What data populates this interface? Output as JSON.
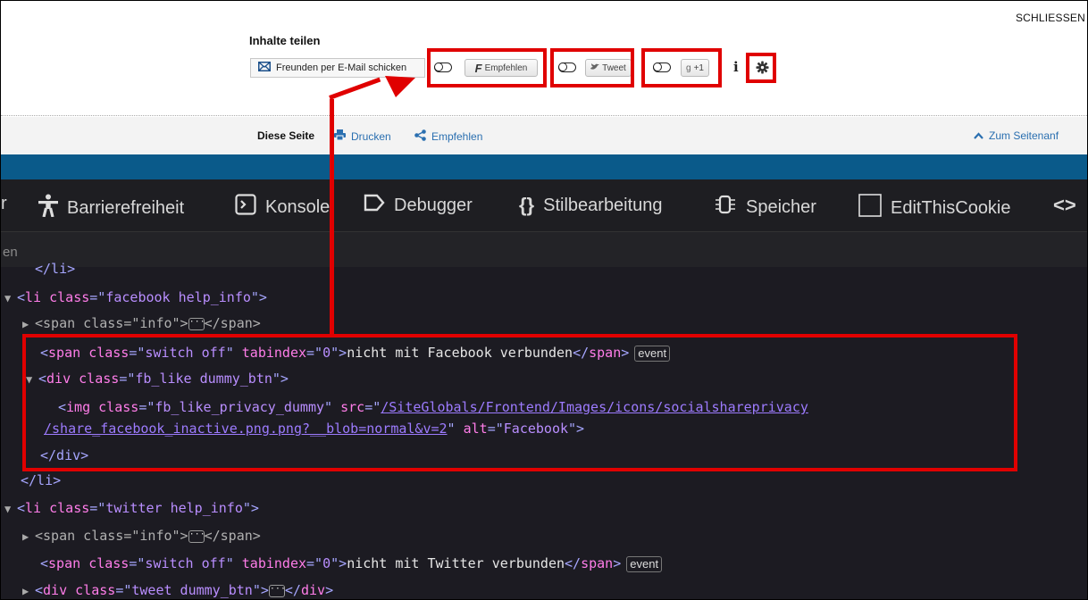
{
  "header": {
    "close_label": "SCHLIESSEN",
    "share_title": "Inhalte teilen"
  },
  "share": {
    "mail_label": "Freunden per E-Mail schicken",
    "facebook_label": "Empfehlen",
    "facebook_glyph": "F",
    "twitter_label": "Tweet",
    "gplus_label": "+1",
    "info_label": "i"
  },
  "pagebar": {
    "this_page": "Diese Seite",
    "print_label": "Drucken",
    "recommend_label": "Empfehlen",
    "top_label": "Zum Seitenanf"
  },
  "devtools": {
    "tabs": [
      {
        "label": "r"
      },
      {
        "label": "Barrierefreiheit"
      },
      {
        "label": "Konsole"
      },
      {
        "label": "Debugger"
      },
      {
        "label": "Stilbearbeitung"
      },
      {
        "label": "Speicher"
      },
      {
        "label": "EditThisCookie"
      }
    ],
    "filter_placeholder": "en"
  },
  "code": {
    "l0": "</li>",
    "l1_class": "facebook help_info",
    "l2_class": "info",
    "l3_class": "switch off",
    "l3_tabindex": "0",
    "l3_text": "nicht mit Facebook verbunden",
    "event_badge": "event",
    "l4_class": "fb_like dummy_btn",
    "l5_class": "fb_like_privacy_dummy",
    "l5_src1": "/SiteGlobals/Frontend/Images/icons/socialshareprivacy",
    "l5_src2": "/share_facebook_inactive.png.png?__blob=normal&v=2",
    "l5_alt": "Facebook",
    "l7": "</div>",
    "l8": "</li>",
    "l9_class": "twitter help_info",
    "l10_class": "info",
    "l11_class": "switch off",
    "l11_tabindex": "0",
    "l11_text": "nicht mit Twitter verbunden",
    "l12_class": "tweet dummy_btn"
  },
  "colors": {
    "highlight": "#e00000",
    "devtools_bg": "#1c1b22",
    "link_blue": "#2a6fb0",
    "site_blue": "#0a5a8a"
  }
}
